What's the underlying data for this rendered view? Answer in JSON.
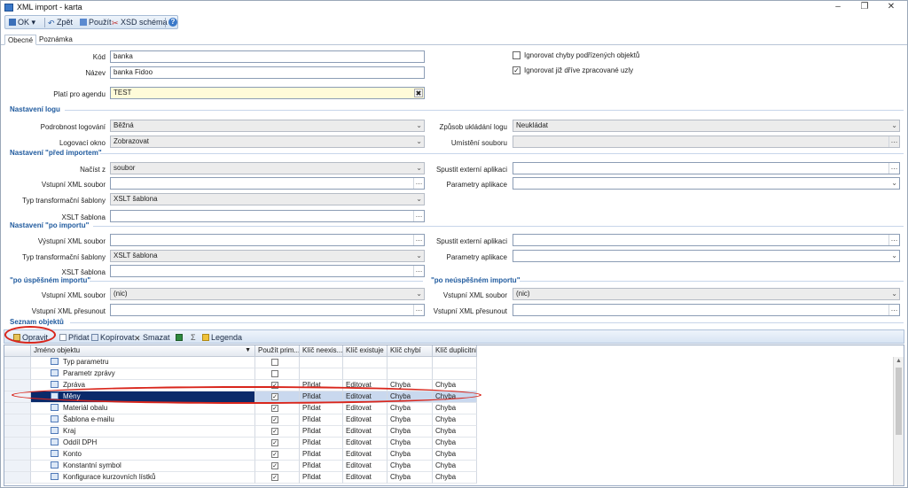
{
  "window": {
    "title": "XML import - karta"
  },
  "toolbar": {
    "ok": "OK",
    "back": "Zpět",
    "apply": "Použít",
    "xsd": "XSD schéma"
  },
  "tabs": [
    "Obecné",
    "Poznámka"
  ],
  "general": {
    "kod_label": "Kód",
    "kod_value": "banka",
    "nazev_label": "Název",
    "nazev_value": "banka Fidoo",
    "agenda_label": "Platí pro agendu",
    "agenda_value": "TEST",
    "chk1_label": "Ignorovat chyby podřízených objektů",
    "chk1_checked": false,
    "chk2_label": "Ignorovat již dříve zpracované uzly",
    "chk2_checked": true
  },
  "log": {
    "title": "Nastavení logu",
    "detail_label": "Podrobnost logování",
    "detail_value": "Běžná",
    "window_label": "Logovací okno",
    "window_value": "Zobrazovat",
    "save_label": "Způsob ukládání logu",
    "save_value": "Neukládat",
    "location_label": "Umístění souboru",
    "location_value": ""
  },
  "before": {
    "title": "Nastavení \"před importem\"",
    "load_label": "Načíst z",
    "load_value": "soubor",
    "xml_label": "Vstupní XML soubor",
    "xml_value": "",
    "transform_label": "Typ transformační šablony",
    "transform_value": "XSLT šablona",
    "xslt_label": "XSLT šablona",
    "xslt_value": "",
    "ext_label": "Spustit externí aplikaci",
    "ext_value": "",
    "params_label": "Parametry aplikace",
    "params_value": ""
  },
  "after": {
    "title": "Nastavení \"po importu\"",
    "xml_label": "Výstupní XML soubor",
    "xml_value": "",
    "transform_label": "Typ transformační šablony",
    "transform_value": "XSLT šablona",
    "xslt_label": "XSLT šablona",
    "xslt_value": "",
    "ext_label": "Spustit externí aplikaci",
    "ext_value": "",
    "params_label": "Parametry aplikace",
    "params_value": ""
  },
  "success": {
    "title": "\"po úspěšném importu\"",
    "xml_label": "Vstupní XML soubor",
    "xml_value": "(nic)",
    "move_label": "Vstupní XML přesunout",
    "move_value": ""
  },
  "failure": {
    "title": "\"po neúspěšném importu\"",
    "xml_label": "Vstupní XML soubor",
    "xml_value": "(nic)",
    "move_label": "Vstupní XML přesunout",
    "move_value": ""
  },
  "objects": {
    "title": "Seznam objektů",
    "toolbar": {
      "edit": "Opravit",
      "add": "Přidat",
      "copy": "Kopírovat",
      "delete": "Smazat",
      "sigma": "Σ",
      "legend": "Legenda"
    },
    "columns": [
      "Jméno objektu",
      "Použít prim...",
      "Klíč neexis...",
      "Klíč existuje",
      "Klíč chybí",
      "Klíč duplicitní"
    ],
    "rows": [
      {
        "name": "Typ parametru",
        "checked": false,
        "missing": "",
        "exists": "",
        "absent": "",
        "dup": ""
      },
      {
        "name": "Parametr zprávy",
        "checked": false,
        "missing": "",
        "exists": "",
        "absent": "",
        "dup": ""
      },
      {
        "name": "Zpráva",
        "checked": true,
        "missing": "Přidat",
        "exists": "Editovat",
        "absent": "Chyba",
        "dup": "Chyba"
      },
      {
        "name": "Měny",
        "checked": true,
        "missing": "Přidat",
        "exists": "Editovat",
        "absent": "Chyba",
        "dup": "Chyba"
      },
      {
        "name": "Materiál obalu",
        "checked": true,
        "missing": "Přidat",
        "exists": "Editovat",
        "absent": "Chyba",
        "dup": "Chyba"
      },
      {
        "name": "Šablona e-mailu",
        "checked": true,
        "missing": "Přidat",
        "exists": "Editovat",
        "absent": "Chyba",
        "dup": "Chyba"
      },
      {
        "name": "Kraj",
        "checked": true,
        "missing": "Přidat",
        "exists": "Editovat",
        "absent": "Chyba",
        "dup": "Chyba"
      },
      {
        "name": "Oddíl DPH",
        "checked": true,
        "missing": "Přidat",
        "exists": "Editovat",
        "absent": "Chyba",
        "dup": "Chyba"
      },
      {
        "name": "Konto",
        "checked": true,
        "missing": "Přidat",
        "exists": "Editovat",
        "absent": "Chyba",
        "dup": "Chyba"
      },
      {
        "name": "Konstantní symbol",
        "checked": true,
        "missing": "Přidat",
        "exists": "Editovat",
        "absent": "Chyba",
        "dup": "Chyba"
      },
      {
        "name": "Konfigurace kurzovních lístků",
        "checked": true,
        "missing": "Přidat",
        "exists": "Editovat",
        "absent": "Chyba",
        "dup": "Chyba"
      }
    ]
  },
  "colors": {
    "accent": "#1f5a9e",
    "highlight": "#d9261c",
    "selected": "#0b2a6a"
  }
}
